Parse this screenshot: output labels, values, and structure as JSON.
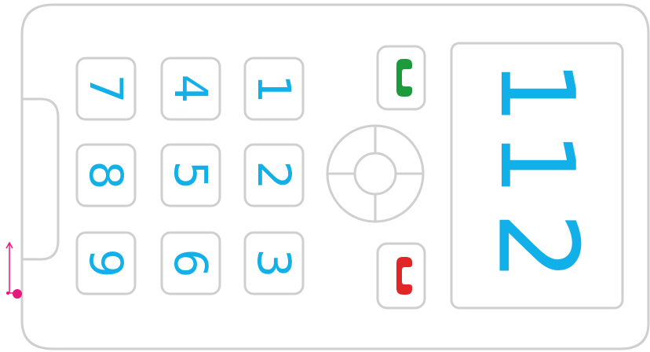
{
  "display": {
    "number": [
      "1",
      "1",
      "2"
    ]
  },
  "keypad": {
    "rows": [
      [
        "7",
        "4",
        "1"
      ],
      [
        "8",
        "5",
        "2"
      ],
      [
        "9",
        "6",
        "3"
      ]
    ]
  },
  "colors": {
    "outline": "#cfcfcf",
    "digits": "#12b0e8",
    "call": "#1d9a3c",
    "hangup": "#e02626",
    "indicator": "#e8197d"
  },
  "icons": {
    "call": "phone-handset-green",
    "hangup": "phone-handset-red",
    "nav": "directional-pad",
    "indicator": "arrow-with-dot"
  }
}
